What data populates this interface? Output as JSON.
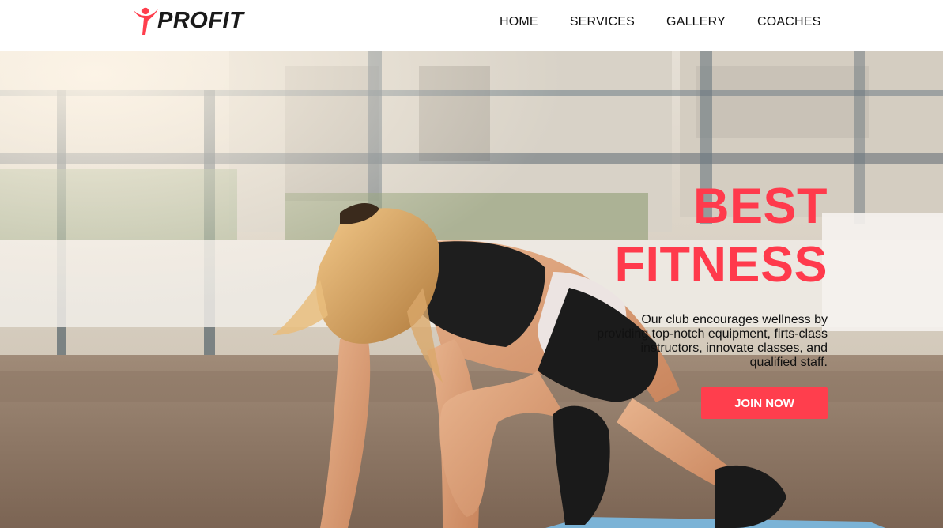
{
  "brand": {
    "name": "PROFIT",
    "icon": "person-figure-icon",
    "accent_color": "#ff3e4d"
  },
  "nav": {
    "items": [
      {
        "label": "HOME"
      },
      {
        "label": "SERVICES"
      },
      {
        "label": "GALLERY"
      },
      {
        "label": "COACHES"
      }
    ]
  },
  "hero": {
    "title_line1": "BEST",
    "title_line2": "FITNESS",
    "description": "Our club encourages wellness by providing top-notch equipment, firts-class instructors, innovate classes, and qualified staff.",
    "cta_label": "JOIN NOW",
    "title_color": "#ff3a4c",
    "image": "woman-doing-mountain-climber-outdoors"
  }
}
